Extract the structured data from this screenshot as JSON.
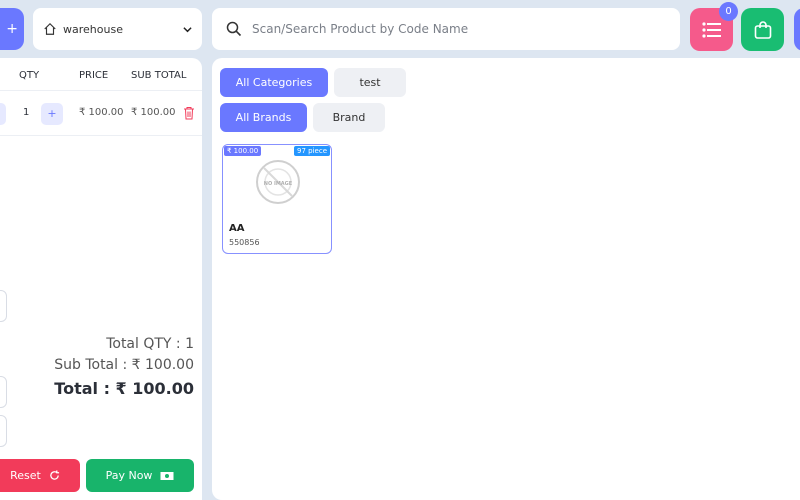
{
  "header": {
    "add_icon": "plus-icon",
    "warehouse": {
      "value": "warehouse",
      "icon": "home-icon"
    },
    "search": {
      "placeholder": "Scan/Search Product by Code Name"
    },
    "list_badge": "0"
  },
  "cart": {
    "columns": {
      "qty": "QTY",
      "price": "PRICE",
      "subtotal": "SUB TOTAL"
    },
    "rows": [
      {
        "qty": "1",
        "price": "₹ 100.00",
        "subtotal": "₹ 100.00"
      }
    ],
    "fields": [
      {
        "suffix": "%"
      },
      {
        "suffix": "₹"
      },
      {
        "suffix": "₹"
      }
    ],
    "total_qty": "Total QTY : 1",
    "sub_total": "Sub Total : ₹ 100.00",
    "total": "Total : ₹ 100.00",
    "reset_label": "Reset",
    "pay_label": "Pay Now"
  },
  "filters": {
    "categories": [
      "All Categories",
      "test"
    ],
    "brands": [
      "All Brands",
      "Brand"
    ]
  },
  "products": [
    {
      "price": "₹ 100.00",
      "stock": "97 piece",
      "name": "AA",
      "code": "550856",
      "image_text": "NO IMAGE"
    }
  ],
  "colors": {
    "accent": "#6a78ff",
    "danger": "#f23b5a",
    "success": "#18b46b",
    "pink": "#f55a8b"
  }
}
